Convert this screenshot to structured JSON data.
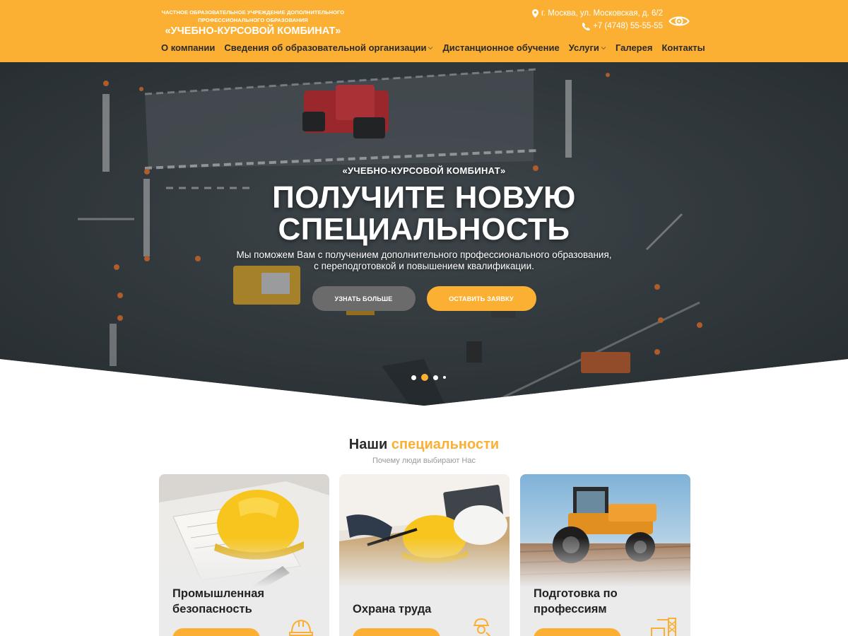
{
  "header": {
    "org_subtitle": "ЧАСТНОЕ ОБРАЗОВАТЕЛЬНОЕ УЧРЕЖДЕНИЕ ДОПОЛНИТЕЛЬНОГО ПРОФЕССИОНАЛЬНОГО ОБРАЗОВАНИЯ",
    "org_name": "«УЧЕБНО-КУРСОВОЙ КОМБИНАТ»",
    "address": "г. Москва, ул. Московская, д. 6/2",
    "phone": "+7 (4748) 55-55-55",
    "accessibility_icon": "eye-icon"
  },
  "nav": {
    "items": [
      {
        "label": "О компании",
        "has_dropdown": false
      },
      {
        "label": "Сведения об образовательной организации",
        "has_dropdown": true
      },
      {
        "label": "Дистанционное обучение",
        "has_dropdown": false
      },
      {
        "label": "Услуги",
        "has_dropdown": true
      },
      {
        "label": "Галерея",
        "has_dropdown": false
      },
      {
        "label": "Контакты",
        "has_dropdown": false
      }
    ]
  },
  "hero": {
    "subtitle": "«УЧЕБНО-КУРСОВОЙ КОМБИНАТ»",
    "title_line1": "ПОЛУЧИТЕ НОВУЮ",
    "title_line2": "СПЕЦИАЛЬНОСТЬ",
    "desc_line1": "Мы поможем Вам с получением дополнительного профессионального образования,",
    "desc_line2": "с переподготовкой и повышением квалификации.",
    "btn_more": "УЗНАТЬ БОЛЬШЕ",
    "btn_apply": "ОСТАВИТЬ ЗАЯВКУ",
    "slider": {
      "total": 4,
      "active": 2
    }
  },
  "specialties": {
    "title_plain": "Наши",
    "title_accent": "специальности",
    "subtitle": "Почему люди выбирают Нас",
    "cards": [
      {
        "title_line1": "Промышленная",
        "title_line2": "безопасность",
        "icon": "helmet-icon"
      },
      {
        "title_line1": "Охрана труда",
        "title_line2": "",
        "icon": "worker-icon"
      },
      {
        "title_line1": "Подготовка по",
        "title_line2": "профессиям",
        "icon": "crane-icon"
      }
    ]
  },
  "colors": {
    "accent": "#fbb034",
    "dark_text": "#2a2a2a",
    "muted_text": "#9a9a9a",
    "button_gray": "#6b6b6b"
  }
}
